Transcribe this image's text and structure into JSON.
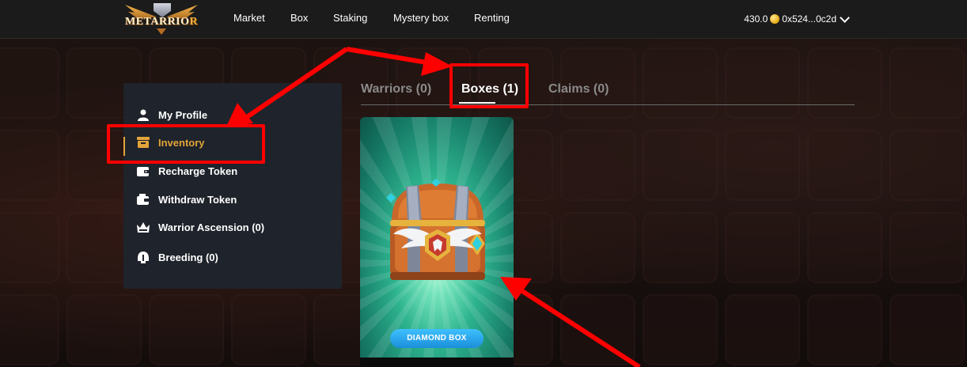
{
  "header": {
    "logo_text": "METARRIOR",
    "nav": [
      "Market",
      "Box",
      "Staking",
      "Mystery box",
      "Renting"
    ],
    "balance": "430.0",
    "address": "0x524...0c2d"
  },
  "sidebar": {
    "items": [
      {
        "label": "My Profile",
        "icon": "user-icon"
      },
      {
        "label": "Inventory",
        "icon": "box-icon"
      },
      {
        "label": "Recharge Token",
        "icon": "wallet-icon"
      },
      {
        "label": "Withdraw Token",
        "icon": "wallet-out-icon"
      },
      {
        "label": "Warrior Ascension (0)",
        "icon": "crown-icon"
      },
      {
        "label": "Breeding (0)",
        "icon": "helmet-icon"
      }
    ],
    "active": "Inventory"
  },
  "tabs": [
    {
      "label": "Warriors (0)"
    },
    {
      "label": "Boxes (1)"
    },
    {
      "label": "Claims (0)"
    }
  ],
  "active_tab": "Boxes (1)",
  "box_card": {
    "name": "DIAMOND BOX"
  },
  "colors": {
    "accent": "#e3a43a",
    "annotation": "#ff0000",
    "box_button": "#2aa6ee"
  }
}
